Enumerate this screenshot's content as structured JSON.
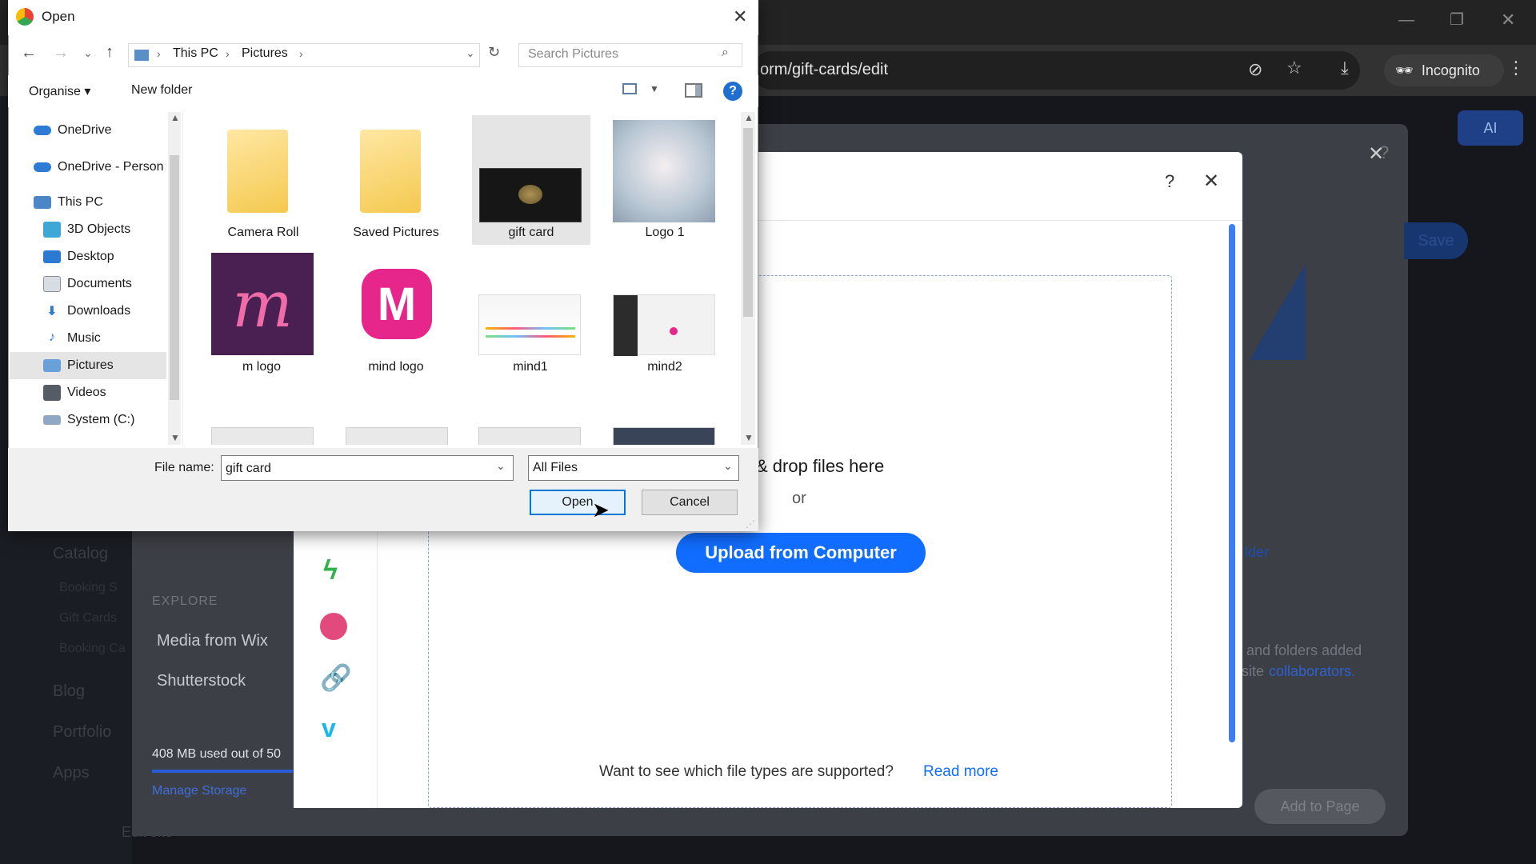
{
  "browser": {
    "url": "orm/gift-cards/edit",
    "incognito_label": "Incognito",
    "ai_label": "AI"
  },
  "editor": {
    "nav": [
      "Catalog",
      "Booking S",
      "Gift Cards",
      "Booking Ca",
      "Blog",
      "Portfolio",
      "Apps"
    ],
    "save_label": "Save",
    "add_to_page": "Add to Page",
    "folder_link": "lder",
    "info_text_1": "and folders added",
    "info_text_2": "site",
    "collaborators": "collaborators.",
    "bottom_text": "Edit site"
  },
  "media": {
    "explore_heading": "EXPLORE",
    "media_from_wix": "Media from Wix",
    "shutterstock": "Shutterstock",
    "storage_text": "408 MB used out of 50",
    "manage_storage": "Manage Storage",
    "drop_text": "& drop files here",
    "or_text": "or",
    "upload_button": "Upload from Computer",
    "supported_q": "Want to see which file types are supported?",
    "read_more": "Read more",
    "help": "?",
    "close": "✕"
  },
  "dialog": {
    "title": "Open",
    "breadcrumb": [
      "This PC",
      "Pictures"
    ],
    "search_placeholder": "Search Pictures",
    "organise": "Organise",
    "new_folder": "New folder",
    "nav_items": [
      {
        "label": "OneDrive",
        "icon": "cloud-icon"
      },
      {
        "label": "OneDrive - Person",
        "icon": "cloud-icon"
      },
      {
        "label": "This PC",
        "icon": "computer-icon"
      },
      {
        "label": "3D Objects",
        "icon": "cube-icon"
      },
      {
        "label": "Desktop",
        "icon": "desktop-icon"
      },
      {
        "label": "Documents",
        "icon": "document-icon"
      },
      {
        "label": "Downloads",
        "icon": "download-icon"
      },
      {
        "label": "Music",
        "icon": "music-icon"
      },
      {
        "label": "Pictures",
        "icon": "pictures-icon"
      },
      {
        "label": "Videos",
        "icon": "video-icon"
      },
      {
        "label": "System (C:)",
        "icon": "drive-icon"
      }
    ],
    "files": [
      {
        "label": "Camera Roll",
        "kind": "folder"
      },
      {
        "label": "Saved Pictures",
        "kind": "folder"
      },
      {
        "label": "gift card",
        "kind": "image-dark"
      },
      {
        "label": "Logo 1",
        "kind": "image-logo"
      },
      {
        "label": "m logo",
        "kind": "image-m"
      },
      {
        "label": "mind  logo",
        "kind": "image-mind"
      },
      {
        "label": "mind1",
        "kind": "image-screen"
      },
      {
        "label": "mind2",
        "kind": "image-screen2"
      }
    ],
    "file_name_label": "File name:",
    "file_name_value": "gift card",
    "filter_value": "All Files",
    "open_button": "Open",
    "cancel_button": "Cancel"
  },
  "colors": {
    "accent": "#116dff",
    "selection": "#e5e5e5"
  }
}
